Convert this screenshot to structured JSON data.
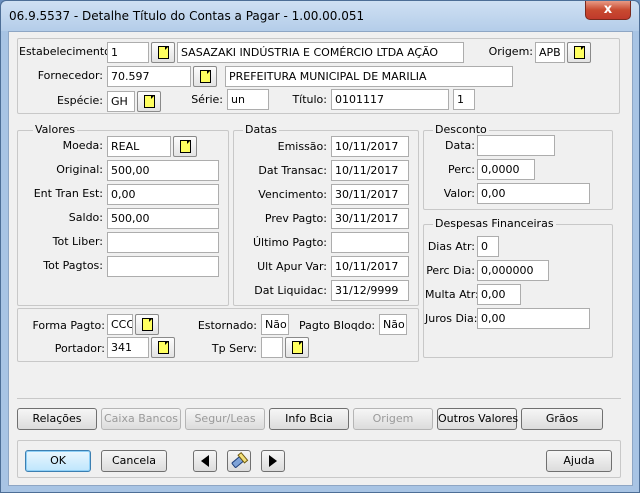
{
  "window": {
    "title": "06.9.5537 - Detalhe Título do Contas a Pagar - 1.00.00.051",
    "close_label": "x"
  },
  "header": {
    "estabelecimento_label": "Estabelecimento:",
    "estabelecimento_code": "1",
    "estabelecimento_name": "SASAZAKI INDÚSTRIA E COMÉRCIO LTDA AÇÃO",
    "origem_label": "Origem:",
    "origem_value": "APB",
    "fornecedor_label": "Fornecedor:",
    "fornecedor_code": "70.597",
    "fornecedor_name": "PREFEITURA MUNICIPAL DE MARILIA",
    "especie_label": "Espécie:",
    "especie_value": "GH",
    "serie_label": "Série:",
    "serie_value": "un",
    "titulo_label": "Título:",
    "titulo_value": "0101117",
    "parcela_value": "1"
  },
  "valores": {
    "title": "Valores",
    "moeda_label": "Moeda:",
    "moeda_value": "REAL",
    "original_label": "Original:",
    "original_value": "500,00",
    "ent_tran_est_label": "Ent Tran Est:",
    "ent_tran_est_value": "0,00",
    "saldo_label": "Saldo:",
    "saldo_value": "500,00",
    "tot_liber_label": "Tot Liber:",
    "tot_liber_value": "",
    "tot_pagtos_label": "Tot Pagtos:",
    "tot_pagtos_value": ""
  },
  "datas": {
    "title": "Datas",
    "emissao_label": "Emissão:",
    "emissao_value": "10/11/2017",
    "dat_transac_label": "Dat Transac:",
    "dat_transac_value": "10/11/2017",
    "vencimento_label": "Vencimento:",
    "vencimento_value": "30/11/2017",
    "prev_pagto_label": "Prev Pagto:",
    "prev_pagto_value": "30/11/2017",
    "ultimo_pagto_label": "Último Pagto:",
    "ultimo_pagto_value": "",
    "ult_apur_var_label": "Ult Apur Var:",
    "ult_apur_var_value": "10/11/2017",
    "dat_liquidac_label": "Dat Liquidac:",
    "dat_liquidac_value": "31/12/9999"
  },
  "desconto": {
    "title": "Desconto",
    "data_label": "Data:",
    "data_value": "",
    "perc_label": "Perc:",
    "perc_value": "0,0000",
    "valor_label": "Valor:",
    "valor_value": "0,00"
  },
  "despesas": {
    "title": "Despesas Financeiras",
    "dias_atr_label": "Dias Atr:",
    "dias_atr_value": "0",
    "perc_dia_label": "Perc Dia:",
    "perc_dia_value": "0,000000",
    "multa_atr_label": "Multa Atr:",
    "multa_atr_value": "0,00",
    "juros_dia_label": "Juros Dia:",
    "juros_dia_value": "0,00"
  },
  "pagamento": {
    "forma_pagto_label": "Forma Pagto:",
    "forma_pagto_value": "CCC",
    "estornado_label": "Estornado:",
    "estornado_value": "Não",
    "pagto_bloqdo_label": "Pagto Bloqdo:",
    "pagto_bloqdo_value": "Não",
    "portador_label": "Portador:",
    "portador_value": "341",
    "tp_serv_label": "Tp Serv:",
    "tp_serv_value": ""
  },
  "action_buttons": {
    "relacoes": "Relações",
    "caixa_bancos": "Caixa Bancos",
    "segur_leas": "Segur/Leas",
    "info_bcia": "Info Bcia",
    "origem": "Origem",
    "outros_valores": "Outros Valores",
    "graos": "Grãos"
  },
  "footer": {
    "ok": "OK",
    "cancela": "Cancela",
    "ajuda": "Ajuda"
  },
  "icons": {
    "lookup": "lookup-document-icon",
    "prev": "triangle-left-icon",
    "next": "triangle-right-icon",
    "search": "search-flashlight-icon"
  },
  "colors": {
    "window_frame": "#a8c4e4",
    "client_bg": "#f0f0f0",
    "close_red": "#c84a30",
    "lookup_yellow": "#ffff60"
  }
}
